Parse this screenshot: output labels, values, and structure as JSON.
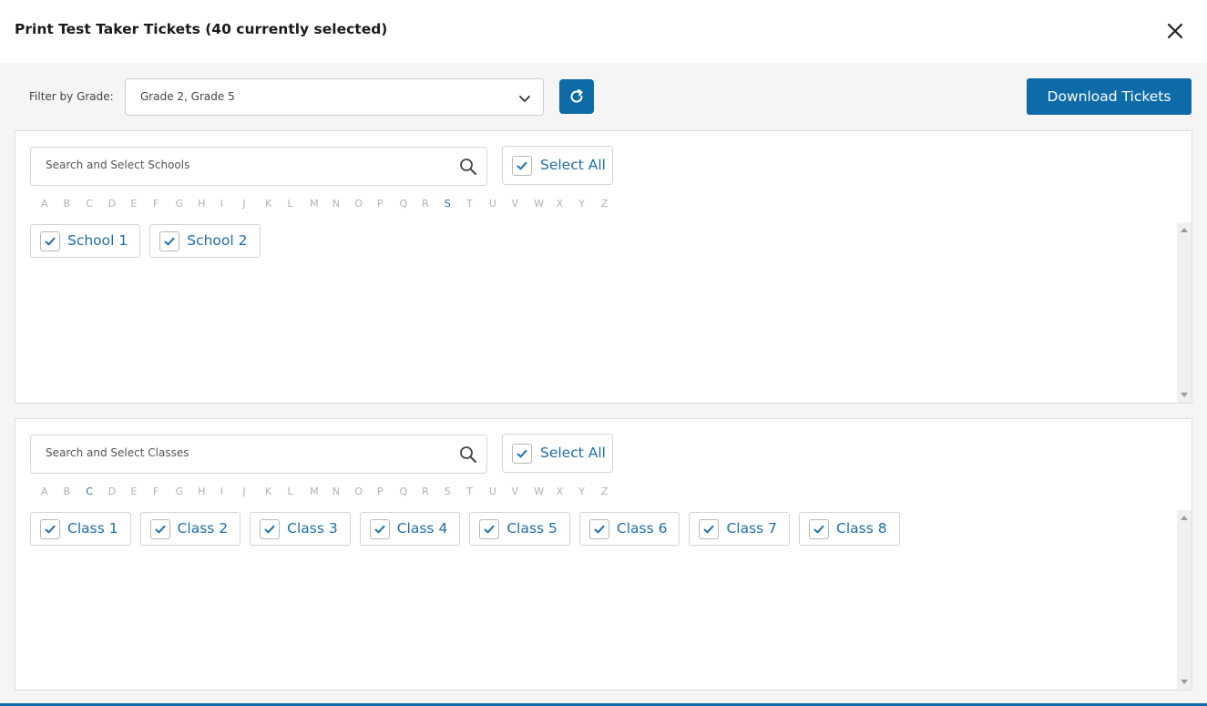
{
  "header": {
    "title": "Print Test Taker Tickets (40 currently selected)"
  },
  "toolbar": {
    "filter_label": "Filter by Grade:",
    "grade_value": "Grade 2, Grade 5",
    "download_label": "Download Tickets"
  },
  "schools": {
    "search_placeholder": "Search and Select Schools",
    "select_all_label": "Select All",
    "select_all_checked": true,
    "active_letter": "S",
    "items": [
      {
        "label": "School 1",
        "checked": true
      },
      {
        "label": "School 2",
        "checked": true
      }
    ]
  },
  "classes": {
    "search_placeholder": "Search and Select Classes",
    "select_all_label": "Select All",
    "select_all_checked": true,
    "active_letter": "C",
    "items": [
      {
        "label": "Class 1",
        "checked": true
      },
      {
        "label": "Class 2",
        "checked": true
      },
      {
        "label": "Class 3",
        "checked": true
      },
      {
        "label": "Class 4",
        "checked": true
      },
      {
        "label": "Class 5",
        "checked": true
      },
      {
        "label": "Class 6",
        "checked": true
      },
      {
        "label": "Class 7",
        "checked": true
      },
      {
        "label": "Class 8",
        "checked": true
      }
    ]
  },
  "alphabet": [
    "A",
    "B",
    "C",
    "D",
    "E",
    "F",
    "G",
    "H",
    "I",
    "J",
    "K",
    "L",
    "M",
    "N",
    "O",
    "P",
    "Q",
    "R",
    "S",
    "T",
    "U",
    "V",
    "W",
    "X",
    "Y",
    "Z"
  ],
  "icons": {
    "close": "close-icon",
    "chevron": "chevron-down-icon",
    "refresh": "refresh-icon",
    "search": "search-icon",
    "check": "checkmark-icon"
  },
  "colors": {
    "accent": "#0f6ba8",
    "link_text": "#1f6fa8",
    "inactive_letter": "#b0b0b0"
  }
}
